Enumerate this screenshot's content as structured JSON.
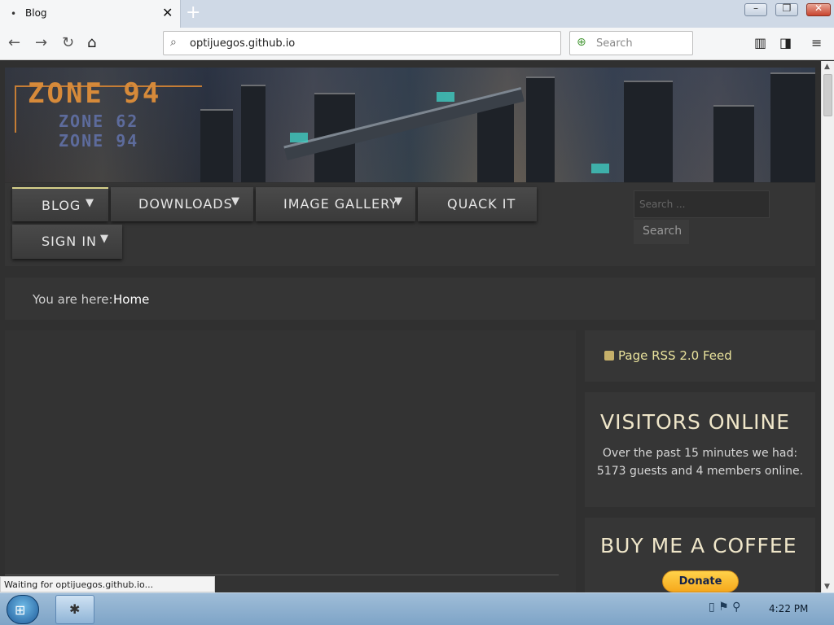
{
  "browser": {
    "tab_title": "Blog",
    "tab_dot": "•",
    "tab_close": "✕",
    "new_tab": "+",
    "url": "optijuegos.github.io",
    "search_placeholder": "Search",
    "icons": [
      "back-arrow-icon",
      "forward-arrow-icon",
      "reload-icon",
      "home-icon",
      "library-icon",
      "sidebar-icon",
      "hamburger-menu-icon"
    ]
  },
  "site": {
    "logo": {
      "main": "ZONE 94",
      "sub_a": "ZONE 62",
      "sub_b": "ZONE 94"
    },
    "menu": [
      {
        "label": "BLOG",
        "arrow": "▼"
      },
      {
        "label": "DOWNLOADS",
        "arrow": "▼"
      },
      {
        "label": "IMAGE GALLERY",
        "arrow": "▼"
      },
      {
        "label": "QUACK IT",
        "arrow": ""
      },
      {
        "label": "SIGN IN",
        "arrow": "▼"
      }
    ],
    "search": {
      "placeholder": "Search ...",
      "button": "Search"
    },
    "breadcrumb": {
      "lead": "You are here:",
      "home": "Home"
    },
    "sidebar": {
      "rss": "Page RSS 2.0 Feed",
      "visitors_title": "VISITORS ONLINE",
      "visitors_body": "Over the past 15 minutes we had: 5173 guests and 4 members online.",
      "coffee_title": "BUY ME A COFFEE",
      "donate": "Donate"
    }
  },
  "status_text": "Waiting for optijuegos.github.io...",
  "taskbar": {
    "clock": "4:22 PM"
  },
  "colors": {
    "accent_gold": "#d68a3a",
    "rss_text": "#e9e29c",
    "heading_cream": "#efe6c9",
    "donate_yellow": "#ffc439"
  }
}
